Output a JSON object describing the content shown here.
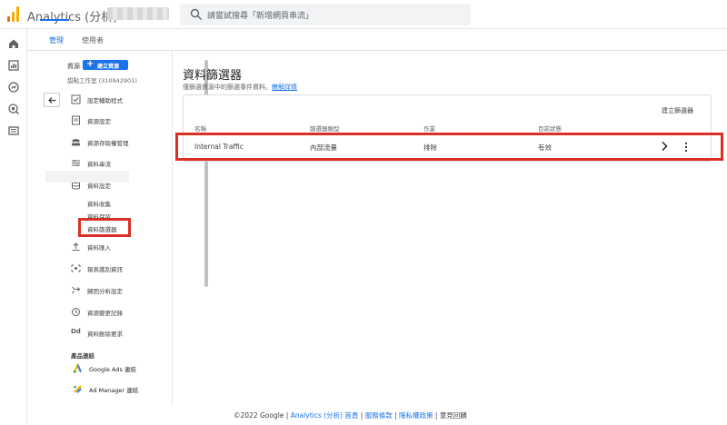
{
  "header": {
    "app_title": "Analytics (分析)",
    "search_placeholder": "請嘗試搜尋「新增網頁串流」"
  },
  "rail": {
    "icons": [
      "home-icon",
      "reports-icon",
      "explore-icon",
      "advertising-icon",
      "list-icon",
      "settings-icon"
    ]
  },
  "tabs": [
    {
      "label": "管理",
      "active": true
    },
    {
      "label": "使用者",
      "active": false
    }
  ],
  "panel": {
    "property_label": "資源",
    "create_property_label": "建立資源",
    "property_name": "甜點工作室 (310942901)",
    "menu_items": [
      {
        "label": "設定輔助程式",
        "icon": "checklist-icon"
      },
      {
        "label": "資源設定",
        "icon": "document-icon"
      },
      {
        "label": "資源存取權管理",
        "icon": "people-icon"
      },
      {
        "label": "資料串流",
        "icon": "streams-icon"
      },
      {
        "label": "資料設定",
        "icon": "database-icon"
      },
      {
        "label": "資料匯入",
        "icon": "upload-icon"
      },
      {
        "label": "報表識別資訊",
        "icon": "identity-icon"
      },
      {
        "label": "歸因分析設定",
        "icon": "attribution-icon"
      },
      {
        "label": "資源變更記錄",
        "icon": "history-icon"
      },
      {
        "label": "資料刪除要求",
        "icon": "dd-icon"
      }
    ],
    "sub_items": [
      "資料收集",
      "資料保留",
      "資料篩選器"
    ],
    "product_links_title": "產品連結",
    "product_links": [
      {
        "label": "Google Ads 連結",
        "icon": "google-ads-icon"
      },
      {
        "label": "Ad Manager 連結",
        "icon": "ad-manager-icon"
      }
    ]
  },
  "main": {
    "title": "資料篩選器",
    "description": "僅篩選資源中的篩選事件資料。",
    "learn_more": "瞭解詳情",
    "create_filter_label": "建立篩選器",
    "columns": [
      "名稱",
      "篩選器類型",
      "作業",
      "目前狀態"
    ],
    "rows": [
      {
        "name": "Internal Traffic",
        "type": "內部流量",
        "operation": "排除",
        "status": "有效"
      }
    ]
  },
  "footer": {
    "copyright": "©2022 Google |",
    "analytics_home": "Analytics (分析) 首頁",
    "terms": "服務條款",
    "privacy": "隱私權政策",
    "feedback": "意見回饋"
  },
  "colors": {
    "accent": "#1a73e8",
    "highlight_red": "#d93025",
    "logo_orange": "#f9ab00",
    "logo_dark": "#e37400"
  }
}
